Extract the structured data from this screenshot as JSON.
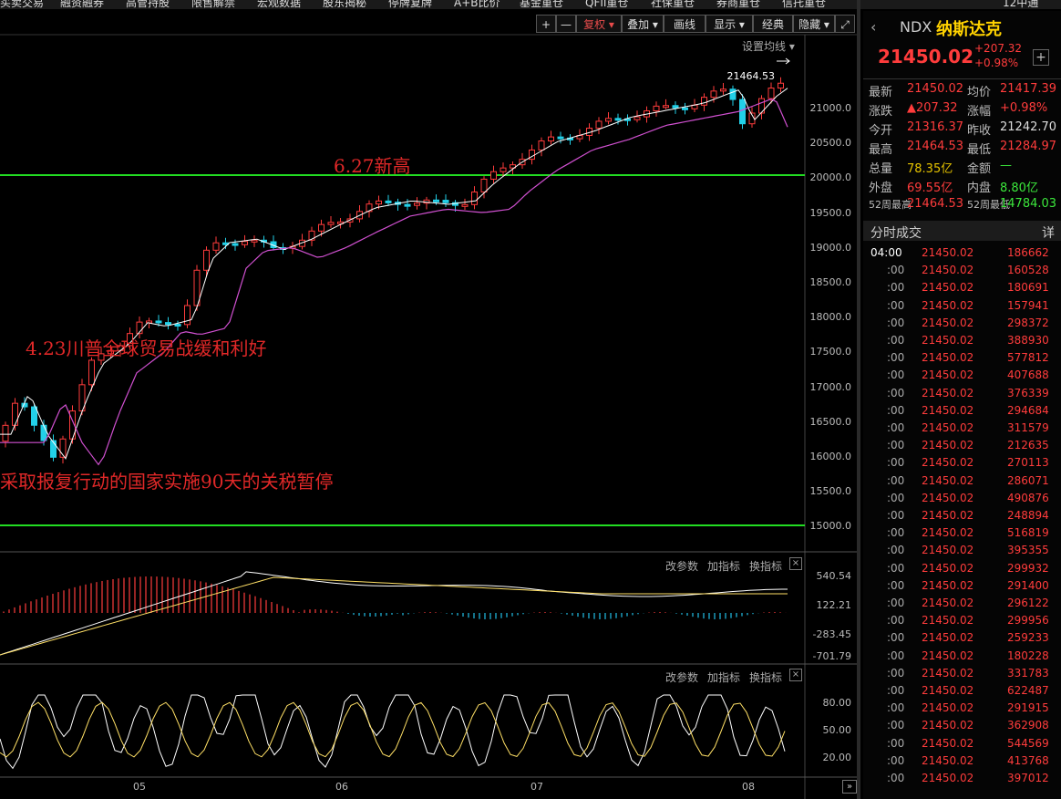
{
  "top_nav": [
    "买卖交易",
    "融资融券",
    "高管持股",
    "限售解禁",
    "宏观数据",
    "股东揭秘",
    "停牌复牌",
    "A+B比价",
    "基金重仓",
    "QFII重仓",
    "社保重仓",
    "券商重仓",
    "信托重仓",
    "12中通"
  ],
  "toolbar": {
    "plus": "+",
    "minus": "—",
    "fuquan": "复权",
    "diejia": "叠加",
    "huaxian": "画线",
    "xianshi": "显示",
    "jingdian": "经典",
    "yincang": "隐藏",
    "expand": "⤢"
  },
  "set_ma": "设置均线",
  "main_chart": {
    "y_ticks": [
      "21000.0",
      "20500.0",
      "20000.0",
      "19500.0",
      "19000.0",
      "18500.0",
      "18000.0",
      "17500.0",
      "17000.0",
      "16500.0",
      "16000.0",
      "15500.0",
      "15000.0"
    ],
    "high_label": "21464.53",
    "annotations": [
      "6.27新高",
      "4.23川普全球贸易战缓和利好",
      "采取报复行动的国家实施90天的关税暂停"
    ]
  },
  "macd_panel": {
    "buttons": [
      "改参数",
      "加指标",
      "换指标"
    ],
    "y_ticks": [
      "540.54",
      "122.21",
      "-283.45",
      "-701.79"
    ]
  },
  "kdj_panel": {
    "buttons": [
      "改参数",
      "加指标",
      "换指标"
    ],
    "y_ticks": [
      "80.00",
      "50.00",
      "20.00"
    ]
  },
  "x_ticks": [
    "05",
    "06",
    "07",
    "08"
  ],
  "quote": {
    "code": "NDX",
    "name": "纳斯达克",
    "price": "21450.02",
    "change": "+207.32",
    "change_pct": "+0.98%",
    "rows": [
      {
        "l1": "最新",
        "v1": "21450.02",
        "l2": "均价",
        "v2": "21417.39"
      },
      {
        "l1": "涨跌",
        "v1": "▲207.32",
        "l2": "涨幅",
        "v2": "+0.98%"
      },
      {
        "l1": "今开",
        "v1": "21316.37",
        "l2": "昨收",
        "v2": "21242.70"
      },
      {
        "l1": "最高",
        "v1": "21464.53",
        "l2": "最低",
        "v2": "21284.97"
      },
      {
        "l1": "总量",
        "v1": "78.35亿",
        "l2": "金额",
        "v2": "—"
      },
      {
        "l1": "外盘",
        "v1": "69.55亿",
        "l2": "内盘",
        "v2": "8.80亿"
      },
      {
        "l1": "52周最高",
        "v1": "21464.53",
        "l2": "52周最低",
        "v2": "14784.03"
      }
    ]
  },
  "ticks_panel": {
    "title": "分时成交",
    "detail": "详",
    "rows": [
      {
        "t": "04:00",
        "p": "21450.02",
        "v": "186662"
      },
      {
        "t": ":00",
        "p": "21450.02",
        "v": "160528"
      },
      {
        "t": ":00",
        "p": "21450.02",
        "v": "180691"
      },
      {
        "t": ":00",
        "p": "21450.02",
        "v": "157941"
      },
      {
        "t": ":00",
        "p": "21450.02",
        "v": "298372"
      },
      {
        "t": ":00",
        "p": "21450.02",
        "v": "388930"
      },
      {
        "t": ":00",
        "p": "21450.02",
        "v": "577812"
      },
      {
        "t": ":00",
        "p": "21450.02",
        "v": "407688"
      },
      {
        "t": ":00",
        "p": "21450.02",
        "v": "376339"
      },
      {
        "t": ":00",
        "p": "21450.02",
        "v": "294684"
      },
      {
        "t": ":00",
        "p": "21450.02",
        "v": "311579"
      },
      {
        "t": ":00",
        "p": "21450.02",
        "v": "212635"
      },
      {
        "t": ":00",
        "p": "21450.02",
        "v": "270113"
      },
      {
        "t": ":00",
        "p": "21450.02",
        "v": "286071"
      },
      {
        "t": ":00",
        "p": "21450.02",
        "v": "490876"
      },
      {
        "t": ":00",
        "p": "21450.02",
        "v": "248894"
      },
      {
        "t": ":00",
        "p": "21450.02",
        "v": "516819"
      },
      {
        "t": ":00",
        "p": "21450.02",
        "v": "395355"
      },
      {
        "t": ":00",
        "p": "21450.02",
        "v": "299932"
      },
      {
        "t": ":00",
        "p": "21450.02",
        "v": "291400"
      },
      {
        "t": ":00",
        "p": "21450.02",
        "v": "296122"
      },
      {
        "t": ":00",
        "p": "21450.02",
        "v": "299956"
      },
      {
        "t": ":00",
        "p": "21450.02",
        "v": "259233"
      },
      {
        "t": ":00",
        "p": "21450.02",
        "v": "180228"
      },
      {
        "t": ":00",
        "p": "21450.02",
        "v": "331783"
      },
      {
        "t": ":00",
        "p": "21450.02",
        "v": "622487"
      },
      {
        "t": ":00",
        "p": "21450.02",
        "v": "291915"
      },
      {
        "t": ":00",
        "p": "21450.02",
        "v": "362908"
      },
      {
        "t": ":00",
        "p": "21450.02",
        "v": "544569"
      },
      {
        "t": ":00",
        "p": "21450.02",
        "v": "413768"
      },
      {
        "t": ":00",
        "p": "21450.02",
        "v": "397012"
      }
    ]
  },
  "colors": {
    "up": "#ff3c3c",
    "down": "#22d0e8",
    "ma_fast": "#ffffff",
    "ma_slow": "#d050d0",
    "hline": "#22dd22"
  }
}
